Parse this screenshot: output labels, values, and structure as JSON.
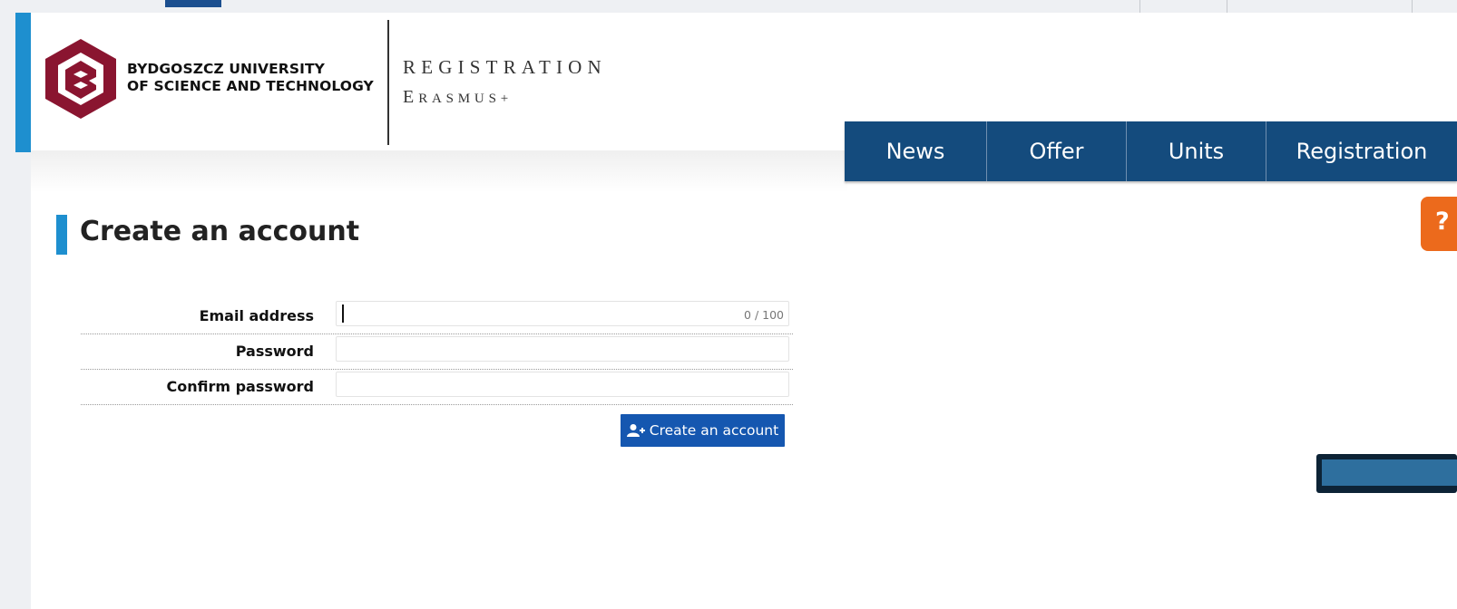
{
  "university": {
    "name_line1": "BYDGOSZCZ UNIVERSITY",
    "name_line2": "OF SCIENCE AND TECHNOLOGY"
  },
  "header": {
    "title": "REGISTRATION",
    "subtitle_initial": "E",
    "subtitle_rest": "RASMUS+"
  },
  "nav": {
    "items": [
      {
        "label": "News"
      },
      {
        "label": "Offer"
      },
      {
        "label": "Units"
      },
      {
        "label": "Registration"
      }
    ]
  },
  "help": {
    "label": "?"
  },
  "page": {
    "title": "Create an account"
  },
  "form": {
    "email_label": "Email address",
    "email_value": "",
    "email_counter": "0 / 100",
    "password_label": "Password",
    "password_value": "",
    "confirm_label": "Confirm password",
    "confirm_value": "",
    "submit_label": "Create an account"
  },
  "colors": {
    "nav_bg": "#144b7d",
    "accent_blue": "#1e8fcf",
    "button_blue": "#1557b0",
    "logo_red": "#8a1530",
    "help_orange": "#ec6a1c"
  },
  "icons": {
    "logo": "university-logo",
    "submit": "add-user-icon"
  }
}
